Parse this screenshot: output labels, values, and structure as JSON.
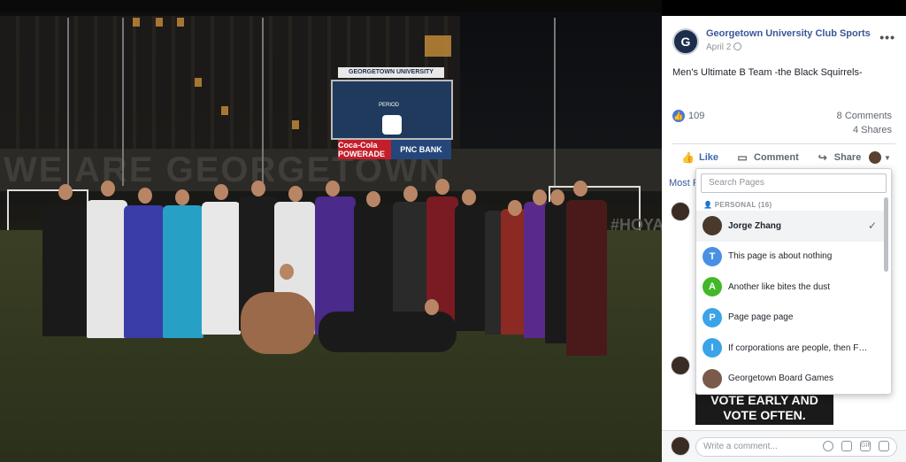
{
  "post": {
    "page_name": "Georgetown University Club Sports",
    "date": "April 2",
    "text": "Men's Ultimate B Team -the Black Squirrels-",
    "like_count": "109",
    "comments": "8 Comments",
    "shares": "4 Shares"
  },
  "photo": {
    "scoreboard_top": "GEORGETOWN UNIVERSITY",
    "scoreboard_period": "PERIOD",
    "sponsor_1": "Coca-Cola POWERADE",
    "sponsor_2": "PNC BANK",
    "sponsor_3": "GEICO",
    "wall_text": "WE ARE GEORGETOWN",
    "banner_text": "#HOYASAXA"
  },
  "actions": {
    "like": "Like",
    "comment": "Comment",
    "share": "Share",
    "most_relevant": "Most R"
  },
  "dropdown": {
    "search_placeholder": "Search Pages",
    "section": "PERSONAL (16)",
    "items": [
      {
        "label": "Jorge Zhang",
        "initial": "",
        "color": "#4a3a2e"
      },
      {
        "label": "This page is about nothing",
        "initial": "T",
        "color": "#4a90e2"
      },
      {
        "label": "Another like bites the dust",
        "initial": "A",
        "color": "#42b72a"
      },
      {
        "label": "Page page page",
        "initial": "P",
        "color": "#3ba3e8"
      },
      {
        "label": "If corporations are people, then FB p...",
        "initial": "I",
        "color": "#3ba3e8"
      },
      {
        "label": "Georgetown Board Games",
        "initial": "",
        "color": "#7a5a4a"
      }
    ]
  },
  "comment_image_text": "VOTE EARLY AND VOTE OFTEN.",
  "comment_box": {
    "placeholder": "Write a comment...",
    "gif_label": "GIF"
  }
}
